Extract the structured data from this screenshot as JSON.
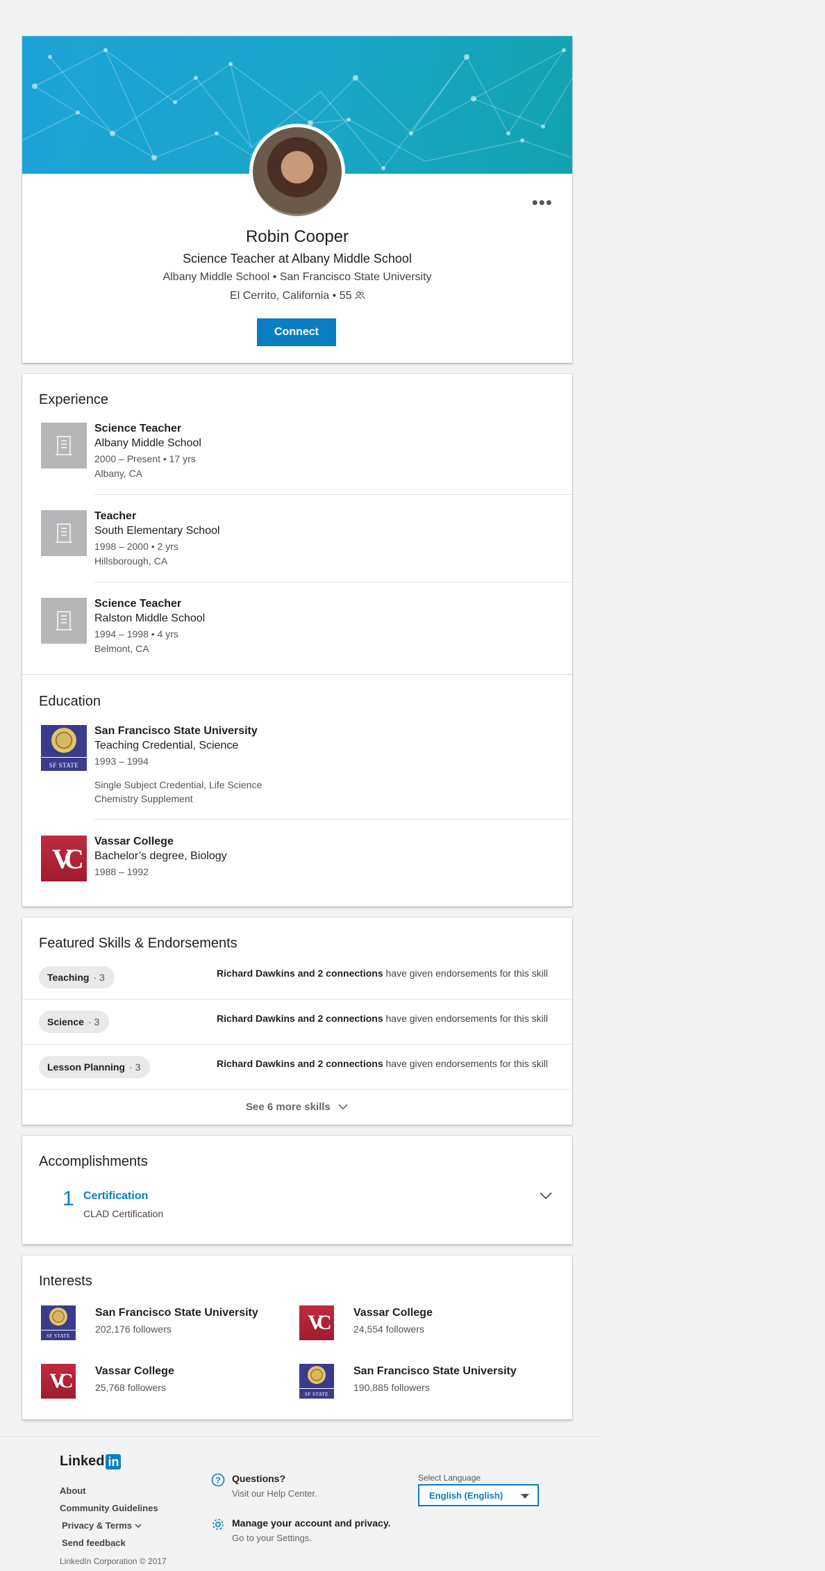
{
  "profile": {
    "name": "Robin Cooper",
    "headline": "Science Teacher at Albany Middle School",
    "subline": "Albany Middle School • San Francisco State University",
    "location": "El Cerrito, California • 55",
    "more": "•••",
    "connect_label": "Connect"
  },
  "experience": {
    "title": "Experience",
    "items": [
      {
        "role": "Science Teacher",
        "org": "Albany Middle School",
        "dates": "2000 – Present  • 17 yrs",
        "place": "Albany, CA"
      },
      {
        "role": "Teacher",
        "org": "South Elementary School",
        "dates": "1998 – 2000  • 2 yrs",
        "place": "Hillsborough, CA"
      },
      {
        "role": "Science Teacher",
        "org": "Ralston Middle School",
        "dates": "1994 – 1998  • 4 yrs",
        "place": "Belmont, CA"
      }
    ]
  },
  "education": {
    "title": "Education",
    "items": [
      {
        "school": "San Francisco State University",
        "degree": "Teaching Credential, Science",
        "dates": "1993 – 1994",
        "note1": "Single Subject Credential, Life Science",
        "note2": "Chemistry Supplement",
        "logo_text": "SF STATE"
      },
      {
        "school": "Vassar College",
        "degree": "Bachelor’s degree, Biology",
        "dates": "1988 – 1992",
        "logo_text": "VC"
      }
    ]
  },
  "skills": {
    "title": "Featured Skills & Endorsements",
    "items": [
      {
        "name": "Teaching",
        "count": "3",
        "endorsers": "Richard Dawkins and 2 connections",
        "text": " have given endorsements for this skill"
      },
      {
        "name": "Science",
        "count": "3",
        "endorsers": "Richard Dawkins and 2 connections",
        "text": " have given endorsements for this skill"
      },
      {
        "name": "Lesson Planning",
        "count": "3",
        "endorsers": "Richard Dawkins and 2 connections",
        "text": " have given endorsements for this skill"
      }
    ],
    "see_more": "See 6 more skills"
  },
  "accomplishments": {
    "title": "Accomplishments",
    "count": "1",
    "category": "Certification",
    "item": "CLAD Certification"
  },
  "interests": {
    "title": "Interests",
    "items": [
      {
        "name": "San Francisco State University",
        "followers": "202,176 followers",
        "logo_text": "SF STATE"
      },
      {
        "name": "Vassar College",
        "followers": "24,554 followers",
        "logo_text": "VC"
      },
      {
        "name": "Vassar College",
        "followers": "25,768 followers",
        "logo_text": "VC"
      },
      {
        "name": "San Francisco State University",
        "followers": "190,885 followers",
        "logo_text": "SF STATE"
      }
    ]
  },
  "footer": {
    "brand": "Linked",
    "brand_in": "in",
    "links": [
      "About",
      "Community Guidelines",
      "Privacy & Terms",
      "Send feedback"
    ],
    "copyright": "LinkedIn Corporation © 2017",
    "help_title": "Questions?",
    "help_sub": "Visit our Help Center.",
    "account_title": "Manage your account and privacy.",
    "account_sub": "Go to your Settings.",
    "lang_label": "Select Language",
    "lang_value": "English (English)"
  },
  "colors": {
    "accent": "#0a7ec2",
    "banner_start": "#1ca3d6",
    "banner_end": "#12a3b0"
  }
}
